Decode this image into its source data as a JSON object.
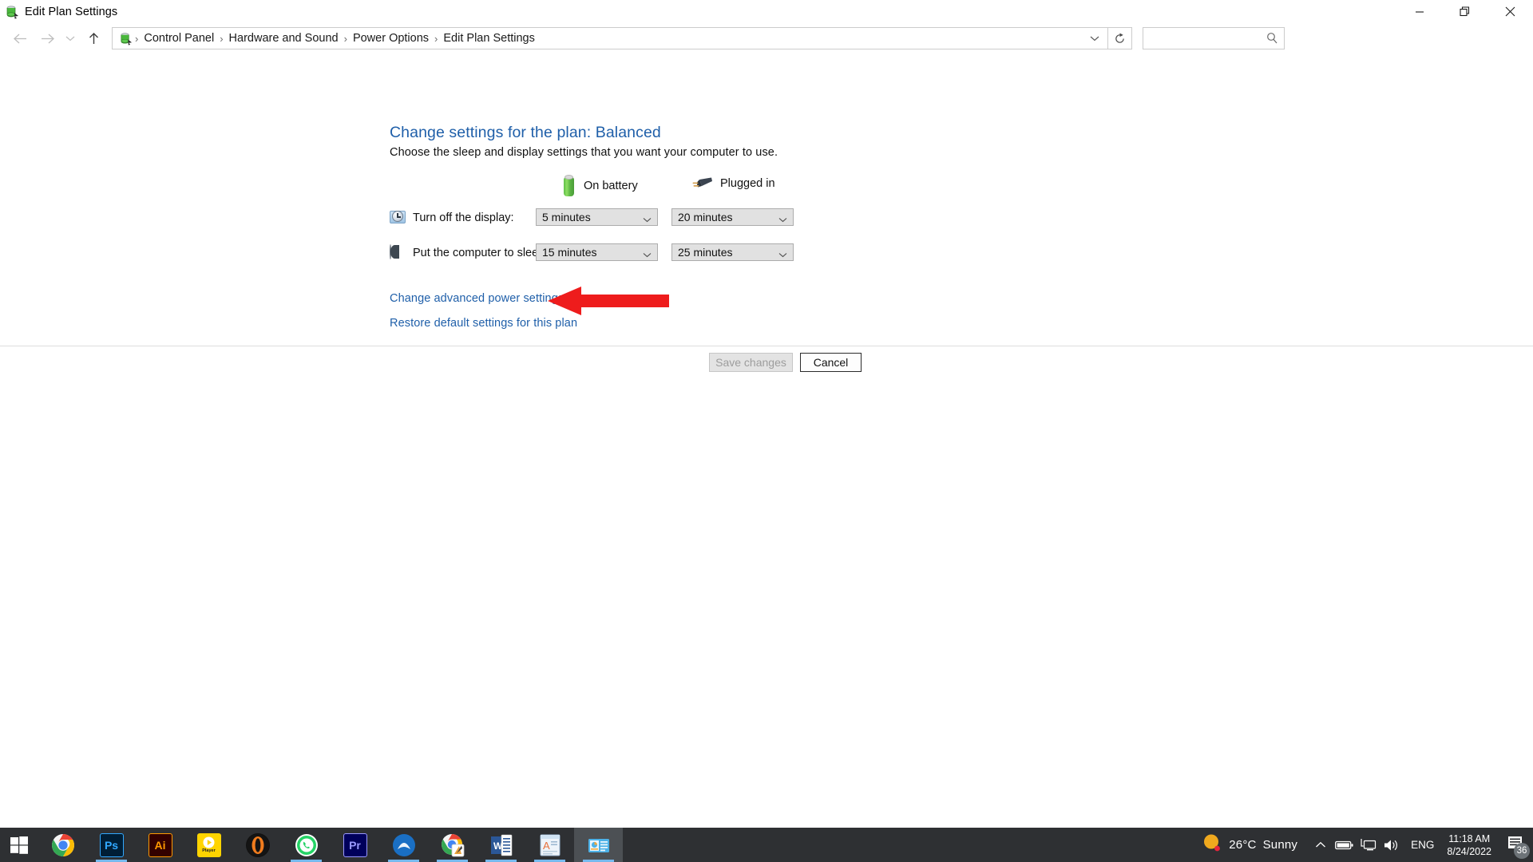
{
  "window": {
    "title": "Edit Plan Settings",
    "icon": "power-plan-icon",
    "controls": {
      "minimize": "Minimize",
      "restore": "Restore",
      "close": "Close"
    }
  },
  "navbar": {
    "back": "Back",
    "forward": "Forward",
    "recent": "Recent locations",
    "up": "Up",
    "breadcrumbs": [
      "Control Panel",
      "Hardware and Sound",
      "Power Options",
      "Edit Plan Settings"
    ],
    "separator": "›",
    "refresh": "Refresh",
    "search_placeholder": "",
    "search_value": ""
  },
  "content": {
    "heading": "Change settings for the plan: Balanced",
    "subheading": "Choose the sleep and display settings that you want your computer to use.",
    "columns": [
      {
        "label": "On battery",
        "icon": "battery-icon"
      },
      {
        "label": "Plugged in",
        "icon": "power-plug-icon"
      }
    ],
    "rows": [
      {
        "icon": "display-clock-icon",
        "label": "Turn off the display:",
        "battery_value": "5 minutes",
        "plugged_value": "20 minutes"
      },
      {
        "icon": "sleep-icon",
        "label": "Put the computer to sleep:",
        "battery_value": "15 minutes",
        "plugged_value": "25 minutes"
      }
    ],
    "links": [
      "Change advanced power settings",
      "Restore default settings for this plan"
    ],
    "annotation": {
      "shape": "red-left-arrow",
      "color": "#ee1c1c",
      "points_to": "Change advanced power settings"
    }
  },
  "footer": {
    "save_label": "Save changes",
    "save_disabled": true,
    "cancel_label": "Cancel"
  },
  "taskbar": {
    "start": "start-icon",
    "items": [
      {
        "name": "chrome",
        "label": "Google Chrome",
        "running": false
      },
      {
        "name": "photoshop",
        "label": "Ps",
        "running": true
      },
      {
        "name": "illustrator",
        "label": "Ai",
        "running": false
      },
      {
        "name": "player",
        "label": "Player",
        "running": false
      },
      {
        "name": "opera-gx",
        "label": "Opera",
        "running": false
      },
      {
        "name": "whatsapp",
        "label": "WhatsApp",
        "running": true
      },
      {
        "name": "premiere-pro",
        "label": "Pr",
        "running": false
      },
      {
        "name": "bluestacks",
        "label": "BlueStacks",
        "running": true
      },
      {
        "name": "chrome-app",
        "label": "Chrome App",
        "running": true
      },
      {
        "name": "word",
        "label": "W",
        "running": true
      },
      {
        "name": "acrobat-reader",
        "label": "Reader",
        "running": true
      },
      {
        "name": "control-panel",
        "label": "Control Panel",
        "running": true,
        "active": true
      }
    ],
    "tray": {
      "weather_temp": "26°C",
      "weather_cond": "Sunny",
      "weather_icon": "sun-icon",
      "show_hidden": "chevron-up-icon",
      "battery": "battery-tray-icon",
      "network": "network-icon",
      "volume": "volume-icon",
      "language": "ENG",
      "time": "11:18 AM",
      "date": "8/24/2022",
      "notifications_icon": "notification-icon",
      "notifications_count": "36"
    }
  },
  "colors": {
    "link": "#1f5fa9",
    "heading": "#1f5fa9",
    "arrow": "#ee1c1c",
    "taskbar": "#2e3033",
    "combo_bg": "#e1e1e1"
  }
}
